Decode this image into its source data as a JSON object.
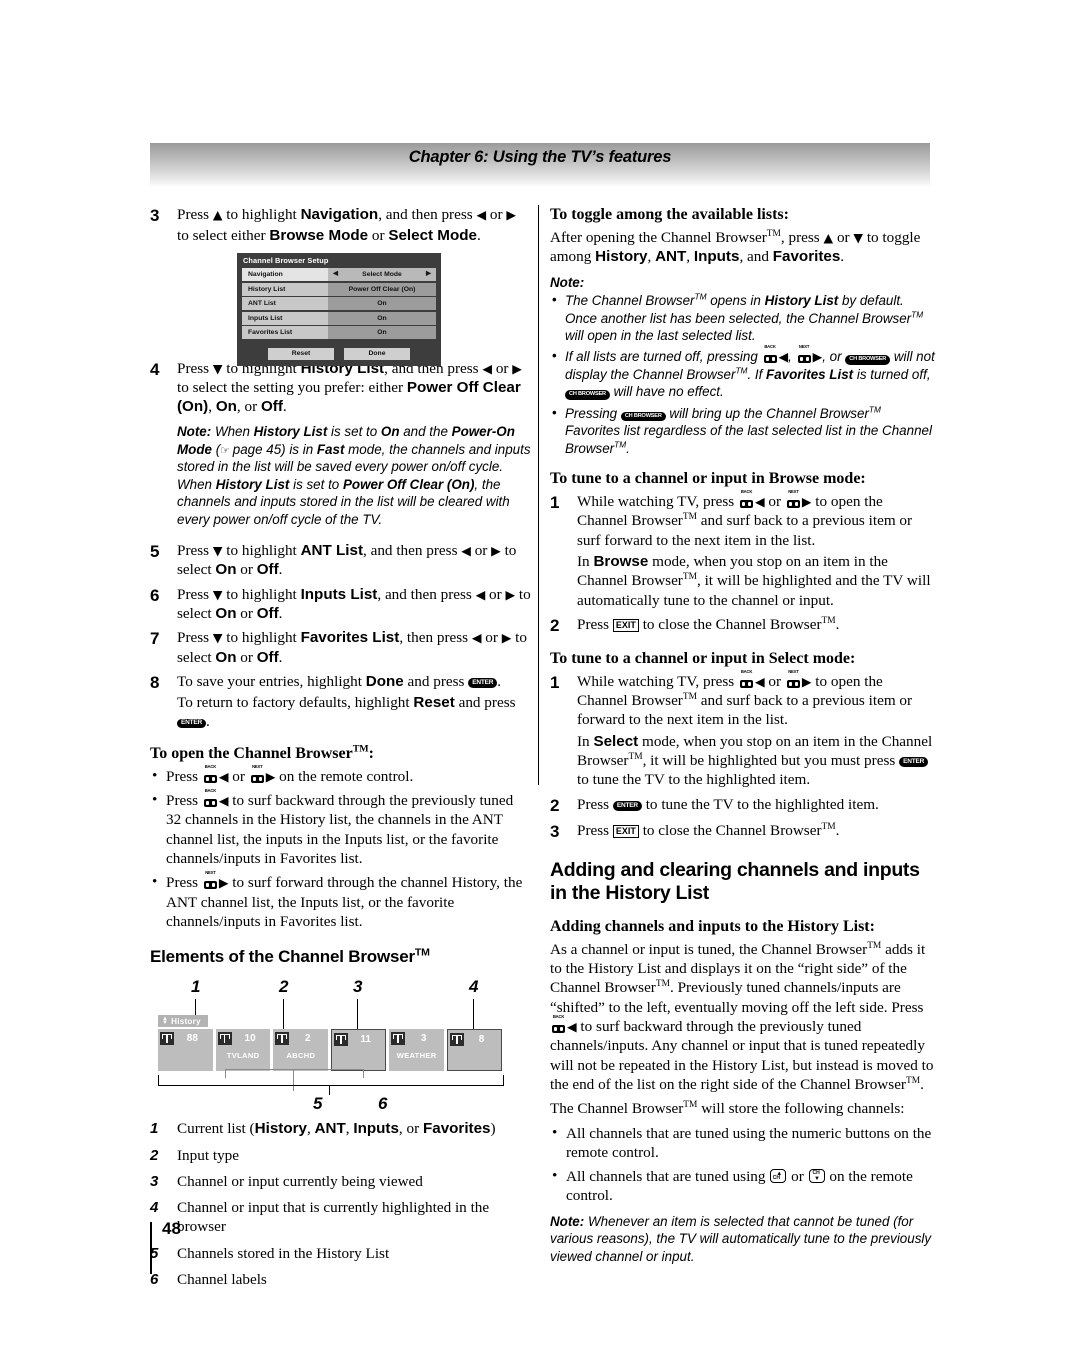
{
  "header": {
    "chapter_title": "Chapter 6: Using the TV’s features"
  },
  "footer": {
    "page_number": "48"
  },
  "left_column": {
    "step3": {
      "num": "3",
      "line1_a": "Press ",
      "line1_b": " to highlight ",
      "nav": "Navigation",
      "line1_c": ", and then press ",
      "line1_d": " or ",
      "line2_a": "to select either ",
      "browse_mode": "Browse Mode",
      "line2_b": " or ",
      "select_mode": "Select Mode",
      "line2_c": "."
    },
    "osd": {
      "title": "Channel Browser Setup",
      "rows": [
        {
          "label": "Navigation",
          "value": "Select Mode",
          "highlighted": true,
          "arrows": true
        },
        {
          "label": "History List",
          "value": "Power Off Clear (On)",
          "highlighted": false,
          "arrows": false
        },
        {
          "label": "ANT List",
          "value": "On",
          "highlighted": false,
          "arrows": false
        },
        {
          "label": "Inputs List",
          "value": "On",
          "highlighted": false,
          "arrows": false
        },
        {
          "label": "Favorites List",
          "value": "On",
          "highlighted": false,
          "arrows": false
        }
      ],
      "buttons": [
        "Reset",
        "Done"
      ]
    },
    "step4": {
      "num": "4",
      "t1": "Press ",
      "t2": " to highlight ",
      "b1": "History List",
      "t3": ", and then press ",
      "t4": " or ",
      "t5": "to select the setting you prefer: either ",
      "b2": "Power Off Clear (On)",
      "t6": ", ",
      "b3": "On",
      "t7": ", or ",
      "b4": "Off",
      "t8": "."
    },
    "step4_note": {
      "label": "Note:",
      "n1": " When ",
      "nb1": "History List",
      "n2": " is set to ",
      "nb2": "On",
      "n3": " and the ",
      "nb3": "Power-On Mode",
      "n4": " (",
      "n5": " page 45) is in ",
      "nb4": "Fast",
      "n6": " mode, the channels and inputs stored in the list will be saved every power on/off cycle. When ",
      "nb5": "History List",
      "n7": " is set to ",
      "nb6": "Power Off Clear (On)",
      "n8": ", the channels and inputs stored in the list will be cleared with every power on/off cycle of the TV."
    },
    "step5": {
      "num": "5",
      "t1": "Press ",
      "t2": " to highlight ",
      "b1": "ANT List",
      "t3": ", and then press ",
      "t4": " or ",
      "t5": " to select ",
      "b2": "On",
      "t6": " or ",
      "b3": "Off",
      "t7": "."
    },
    "step6": {
      "num": "6",
      "t1": "Press ",
      "t2": " to highlight ",
      "b1": "Inputs List",
      "t3": ", and then press ",
      "t4": " or ",
      "t5": " to select ",
      "b2": "On",
      "t6": " or ",
      "b3": "Off",
      "t7": "."
    },
    "step7": {
      "num": "7",
      "t1": "Press ",
      "t2": " to highlight ",
      "b1": "Favorites List",
      "t3": ", then press ",
      "t4": " or ",
      "t5": " to select ",
      "b2": "On",
      "t6": " or ",
      "b3": "Off",
      "t7": "."
    },
    "step8": {
      "num": "8",
      "t1": "To save your entries, highlight ",
      "b1": "Done",
      "t2": " and press ",
      "t3": ".",
      "t4": "To return to factory defaults, highlight ",
      "b2": "Reset",
      "t5": " and press ",
      "t6": "."
    },
    "open_browser": {
      "heading_a": "To open the Channel Browser",
      "heading_b": ":",
      "bullet1_a": "Press ",
      "bullet1_b": " or ",
      "bullet1_c": " on the remote control.",
      "bullet2_a": "Press ",
      "bullet2_b": " to surf backward through the previously tuned 32 channels in the History list, the channels in the ANT channel list, the inputs in the Inputs list, or the favorite channels/inputs in Favorites list.",
      "bullet3_a": "Press ",
      "bullet3_b": " to surf forward through the channel History, the ANT channel list, the Inputs list, or the favorite channels/inputs in Favorites list."
    },
    "elements_heading_a": "Elements of the Channel Browser",
    "figure": {
      "tab_label": "History",
      "callouts": [
        "1",
        "2",
        "3",
        "4",
        "5",
        "6"
      ],
      "cells": [
        {
          "number": "88",
          "label": "",
          "outlined": false
        },
        {
          "number": "10",
          "label": "TVLAND",
          "outlined": false
        },
        {
          "number": "2",
          "label": "ABCHD",
          "outlined": false
        },
        {
          "number": "11",
          "label": "",
          "outlined": true
        },
        {
          "number": "3",
          "label": "WEATHER",
          "outlined": false
        },
        {
          "number": "8",
          "label": "",
          "outlined": true
        }
      ]
    },
    "definitions": [
      {
        "num": "1",
        "parts": [
          "Current list (",
          "History",
          ", ",
          "ANT",
          ", ",
          "Inputs",
          ", or ",
          "Favorites",
          ")"
        ]
      },
      {
        "num": "2",
        "text": "Input type"
      },
      {
        "num": "3",
        "text": "Channel or input currently being viewed"
      },
      {
        "num": "4",
        "text": "Channel or input that is currently highlighted in the browser"
      },
      {
        "num": "5",
        "text": "Channels stored in the History List"
      },
      {
        "num": "6",
        "text": "Channel labels"
      }
    ]
  },
  "right_column": {
    "toggle": {
      "heading": "To toggle among the available lists:",
      "p1_a": "After opening the Channel Browser",
      "p1_b": ", press ",
      "p1_c": " or ",
      "p1_d": " to toggle among ",
      "b1": "History",
      "p1_e": ", ",
      "b2": "ANT",
      "p1_f": ", ",
      "b3": "Inputs",
      "p1_g": ", and ",
      "b4": "Favorites",
      "p1_h": "."
    },
    "toggle_note": {
      "label": "Note:",
      "bullets": [
        {
          "a": "The Channel Browser",
          "b": " opens in ",
          "bold1": "History List",
          "c": " by default. Once another list has been selected, the Channel Browser",
          "d": " will open in the last selected list."
        },
        {
          "a": "If all lists are turned off, pressing ",
          "b": ", ",
          "c": ", or ",
          "d": " will not display the Channel Browser",
          "e": ". If ",
          "bold1": "Favorites List",
          "f": " is turned off, ",
          "g": " will have no effect."
        },
        {
          "a": "Pressing ",
          "b": " will bring up the Channel Browser",
          "c": " Favorites list regardless of the last selected list in the Channel Browser",
          "d": "."
        }
      ]
    },
    "browse_mode": {
      "heading": "To tune to a channel or input in Browse mode:",
      "step1": {
        "num": "1",
        "t1": "While watching TV, press ",
        "t2": " or ",
        "t3": " to open the Channel Browser",
        "t4": " and surf back to a previous item or surf forward to the next item in the list.",
        "p2_a": "In ",
        "p2_b": "Browse",
        "p2_c": " mode, when you stop on an item in the Channel Browser",
        "p2_d": ", it will be highlighted and the TV will automatically tune to the channel or input."
      },
      "step2": {
        "num": "2",
        "t1": "Press ",
        "t2": " to close the Channel Browser",
        "t3": "."
      }
    },
    "select_mode": {
      "heading": "To tune to a channel or input in Select mode:",
      "step1": {
        "num": "1",
        "t1": "While watching TV, press ",
        "t2": " or ",
        "t3": " to open the Channel Browser",
        "t4": " and surf back to a previous item or forward to the next item in the list.",
        "p2_a": "In ",
        "p2_b": "Select",
        "p2_c": " mode, when you stop on an item in the Channel Browser",
        "p2_d": ", it will be highlighted but you must press ",
        "p2_e": " to tune the TV to the highlighted item."
      },
      "step2": {
        "num": "2",
        "t1": "Press ",
        "t2": " to tune the TV to the highlighted item."
      },
      "step3": {
        "num": "3",
        "t1": "Press ",
        "t2": " to close the Channel Browser",
        "t3": "."
      }
    },
    "adding_section": {
      "heading": "Adding and clearing channels and inputs in the History List",
      "sub_heading": "Adding channels and inputs to the History List:",
      "p1_a": "As a channel or input is tuned, the Channel Browser",
      "p1_b": " adds it to the History List and displays it on the “right side” of the Channel Browser",
      "p1_c": ". Previously tuned channels/inputs are “shifted” to the left, eventually moving off the left side. Press ",
      "p1_d": " to surf backward through the previously tuned channels/inputs. Any channel or input that is tuned repeatedly will not be repeated in the History List, but instead is moved to the end of the list on the right side of the Channel Browser",
      "p1_e": ".",
      "p2_a": "The Channel Browser",
      "p2_b": " will store the following channels:",
      "bullet1": "All channels that are tuned using the numeric buttons on the remote control.",
      "bullet2_a": "All channels that are tuned using ",
      "bullet2_b": " or ",
      "bullet2_c": " on the remote control.",
      "note_label": "Note:",
      "note_text": " Whenever an item is selected that cannot be tuned (for various reasons), the TV will automatically tune to the previously viewed channel or input."
    }
  },
  "glyphs": {
    "arrow_up": "▲",
    "arrow_down": "▼",
    "arrow_left": "◀",
    "arrow_right": "▶",
    "back_key_label": "BACK",
    "next_key_label": "NEXT",
    "enter_key_label": "ENTER",
    "exit_key_label": "EXIT",
    "browser_key_label": "CH BROWSER",
    "ch_up_label": "CH",
    "ch_down_label": "CH",
    "trademark": "TM"
  },
  "colors": {
    "header_gradient_top": "#9a9a9a",
    "header_gradient_bottom": "#ffffff",
    "osd_background": "#3d3d3d",
    "osd_label_bg": "#c8c8c8",
    "osd_value_bg": "#9c9c9c",
    "cell_bg": "#bdbdbd",
    "cell_outline": "#4a4a4a",
    "tab_bg": "#b3b3b3"
  }
}
